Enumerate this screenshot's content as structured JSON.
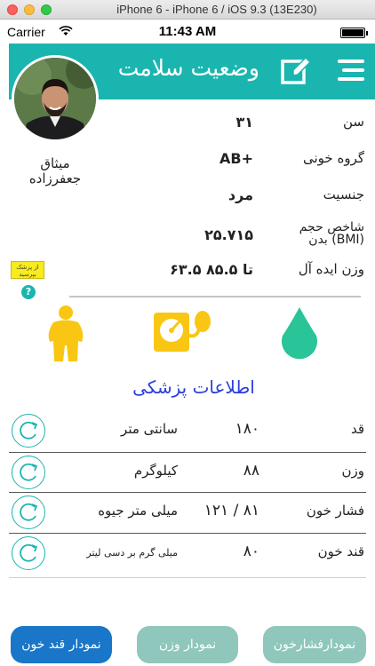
{
  "window": {
    "title": "iPhone 6 - iPhone 6 / iOS 9.3 (13E230)"
  },
  "status_bar": {
    "carrier": "Carrier",
    "time": "11:43 AM"
  },
  "header": {
    "title": "وضعیت سلامت"
  },
  "user": {
    "name_first": "میثاق",
    "name_last": "جعفرزاده"
  },
  "profile": {
    "age": {
      "label": "سن",
      "value": "۳۱"
    },
    "blood_type": {
      "label": "گروه خونی",
      "value": "AB+"
    },
    "gender": {
      "label": "جنسیت",
      "value": "مرد"
    },
    "bmi": {
      "label_line1": "شاخص حجم",
      "label_line2": "بدن (BMI)",
      "value": "۲۵.۷۱۵"
    },
    "ideal_weight": {
      "label": "وزن ایده آل",
      "value": "۶۳.۵ تا ۸۵.۵"
    }
  },
  "badge": {
    "line1": "از پزشک",
    "line2": "بپرسید",
    "help": "?"
  },
  "section_title": "اطلاعات پزشکی",
  "medical": [
    {
      "label": "قد",
      "value": "۱۸۰",
      "unit": "سانتی متر"
    },
    {
      "label": "وزن",
      "value": "۸۸",
      "unit": "کیلوگرم"
    },
    {
      "label": "فشار خون",
      "value": "۱۲۱ / ۸۱",
      "unit": "میلی متر جیوه"
    },
    {
      "label": "قند خون",
      "value": "۸۰",
      "unit": "میلی گرم بر دسی لیتر"
    }
  ],
  "buttons": {
    "blood_sugar_chart": "نمودار قند خون",
    "weight_chart": "نمودار وزن",
    "blood_pressure_chart": "نمودارفشارخون"
  },
  "colors": {
    "accent": "#1bb5b0",
    "icon_yellow": "#f9c613",
    "title_blue": "#2a3ddb",
    "primary_button": "#1976c9",
    "secondary_button": "#8fc7bc"
  }
}
